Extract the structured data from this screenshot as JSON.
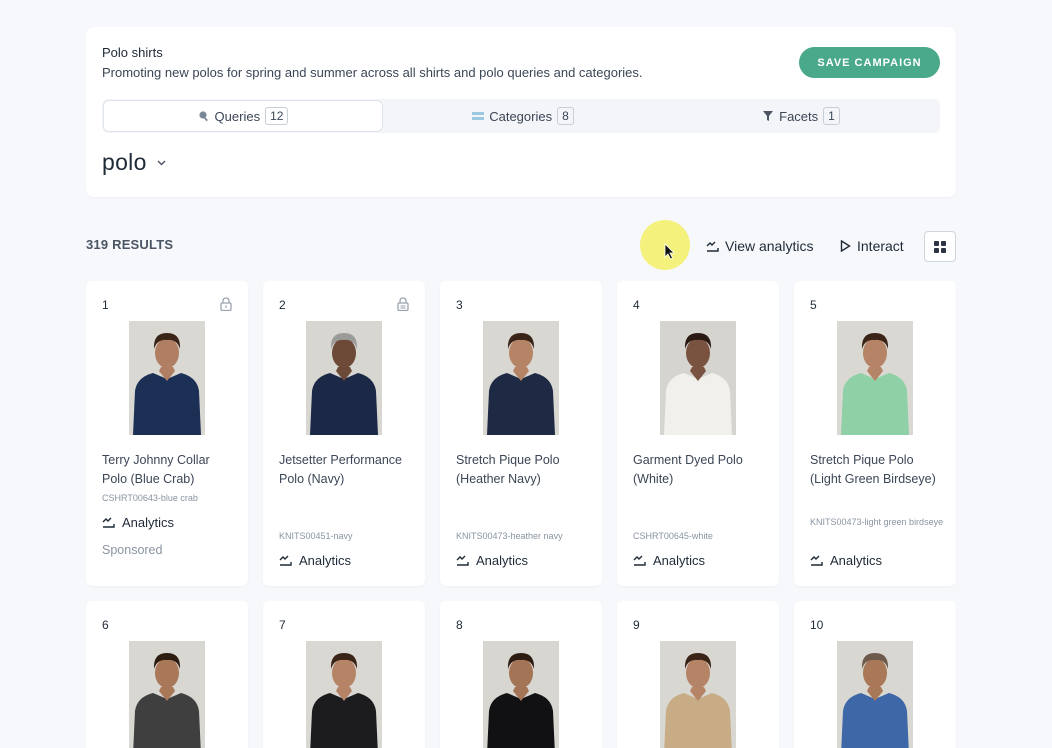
{
  "campaign": {
    "title": "Polo shirts",
    "description": "Promoting new polos for spring and summer across all shirts and polo queries and categories.",
    "save_label": "SAVE CAMPAIGN"
  },
  "tabs": [
    {
      "label": "Queries",
      "count": "12",
      "icon": "search-icon"
    },
    {
      "label": "Categories",
      "count": "8",
      "icon": "category-icon"
    },
    {
      "label": "Facets",
      "count": "1",
      "icon": "filter-icon"
    }
  ],
  "query": {
    "value": "polo"
  },
  "results": {
    "count_label": "319 RESULTS"
  },
  "toolbar": {
    "view_analytics": "View analytics",
    "interact": "Interact"
  },
  "colors": {
    "accent": "#4aa88b",
    "cursor_highlight": "#f4f06e",
    "background": "#f6f8fb"
  },
  "products": [
    {
      "rank": "1",
      "name": "Terry Johnny Collar Polo (Blue Crab)",
      "sku": "CSHRT00643-blue crab",
      "analytics": "Analytics",
      "sponsored": "Sponsored",
      "lock": "lock-icon",
      "shirt": "#1c2f55",
      "bg": "#d9d8d3",
      "skin": "#b07f63",
      "hair": "#3a2417"
    },
    {
      "rank": "2",
      "name": "Jetsetter Performance Polo (Navy)",
      "sku": "KNITS00451-navy",
      "analytics": "Analytics",
      "lock": "lock-rule-icon",
      "shirt": "#1b2846",
      "bg": "#d8d6d0",
      "skin": "#6d4a38",
      "hair": "#9a9a96"
    },
    {
      "rank": "3",
      "name": "Stretch Pique Polo (Heather Navy)",
      "sku": "KNITS00473-heather navy",
      "analytics": "Analytics",
      "shirt": "#1e2a44",
      "bg": "#d9d7d1",
      "skin": "#b58466",
      "hair": "#3a2417"
    },
    {
      "rank": "4",
      "name": "Garment Dyed Polo (White)",
      "sku": "CSHRT00645-white",
      "analytics": "Analytics",
      "shirt": "#f1f0ec",
      "bg": "#d6d4ce",
      "skin": "#7a5240",
      "hair": "#2a1a12"
    },
    {
      "rank": "5",
      "name": "Stretch Pique Polo (Light Green Birdseye)",
      "sku": "KNITS00473-light green birdseye",
      "analytics": "Analytics",
      "shirt": "#8fd0a6",
      "bg": "#d9d8d2",
      "skin": "#b58466",
      "hair": "#3a2417"
    },
    {
      "rank": "6",
      "shirt": "#3f3f40",
      "bg": "#d8d7d1",
      "skin": "#a87858",
      "hair": "#2d1c12"
    },
    {
      "rank": "7",
      "shirt": "#1c1c1e",
      "bg": "#d9d8d2",
      "skin": "#b58466",
      "hair": "#3a2417"
    },
    {
      "rank": "8",
      "shirt": "#111113",
      "bg": "#d8d6d0",
      "skin": "#a47456",
      "hair": "#2d1c12"
    },
    {
      "rank": "9",
      "shirt": "#c7ac86",
      "bg": "#d9d7d1",
      "skin": "#b58466",
      "hair": "#3a2417"
    },
    {
      "rank": "10",
      "shirt": "#3e67a8",
      "bg": "#d8d7d1",
      "skin": "#a87858",
      "hair": "#6d5a4c"
    }
  ]
}
